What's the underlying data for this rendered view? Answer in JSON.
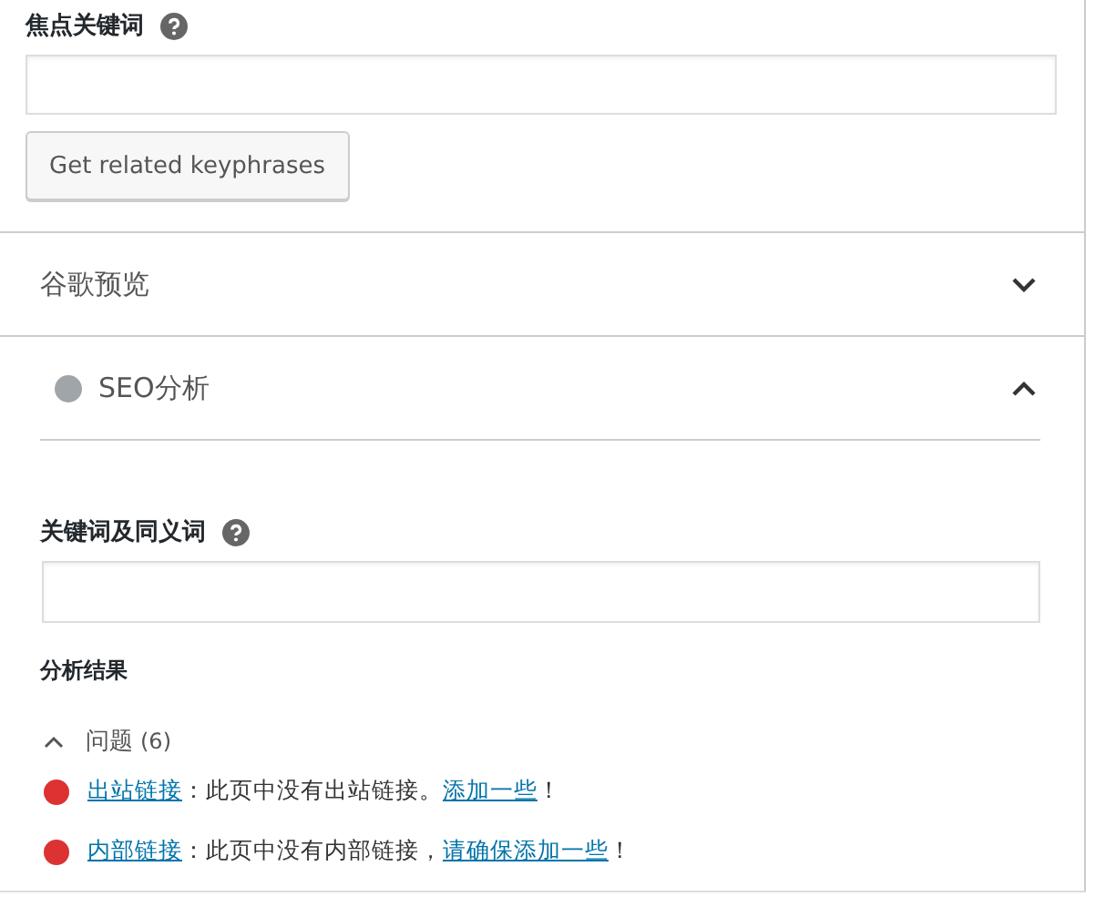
{
  "focus_keyphrase": {
    "label": "焦点关键词",
    "button": "Get related keyphrases"
  },
  "sections": [
    {
      "title": "谷歌预览",
      "expanded": false,
      "has_dot": false
    },
    {
      "title": "SEO分析",
      "expanded": true,
      "has_dot": true,
      "color": "#a0a5aa"
    }
  ],
  "seo": {
    "synonyms_label": "关键词及同义词",
    "results_heading": "分析结果",
    "problems": {
      "label": "问题",
      "count": "(6)",
      "expanded": true
    },
    "issues": [
      {
        "color": "#dc3232",
        "link": "出站链接",
        "text": "：此页中没有出站链接。",
        "action": "添加一些",
        "end": "！"
      },
      {
        "color": "#dc3232",
        "link": "内部链接",
        "text": "：此页中没有内部链接，",
        "action": "请确保添加一些",
        "end": "！"
      }
    ]
  }
}
